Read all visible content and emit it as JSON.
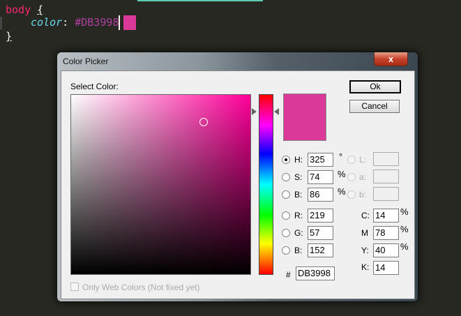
{
  "editor": {
    "selector": "body",
    "open_brace": "{",
    "property": "color",
    "colon": ":",
    "value": "#DB3998",
    "close_brace": "}"
  },
  "dialog": {
    "title": "Color Picker",
    "close_label": "x",
    "select_label": "Select Color:",
    "ok_label": "Ok",
    "cancel_label": "Cancel",
    "hsb": [
      {
        "label": "H:",
        "value": "325",
        "unit": "°",
        "checked": true
      },
      {
        "label": "S:",
        "value": "74",
        "unit": "%"
      },
      {
        "label": "B:",
        "value": "86",
        "unit": "%"
      }
    ],
    "lab": [
      {
        "label": "L:",
        "value": ""
      },
      {
        "label": "a:",
        "value": ""
      },
      {
        "label": "b:",
        "value": ""
      }
    ],
    "rgb": [
      {
        "label": "R:",
        "value": "219"
      },
      {
        "label": "G:",
        "value": "57"
      },
      {
        "label": "B:",
        "value": "152"
      }
    ],
    "cmyk": [
      {
        "label": "C:",
        "value": "14",
        "unit": "%"
      },
      {
        "label": "M",
        "value": "78",
        "unit": "%"
      },
      {
        "label": "Y:",
        "value": "40",
        "unit": "%"
      },
      {
        "label": "K:",
        "value": "14",
        "unit": ""
      }
    ],
    "hash_label": "#",
    "hex": "DB3998",
    "web_colors_label": "Only Web Colors (Not fixed yet)"
  },
  "colors": {
    "selected": "#DB3998"
  }
}
